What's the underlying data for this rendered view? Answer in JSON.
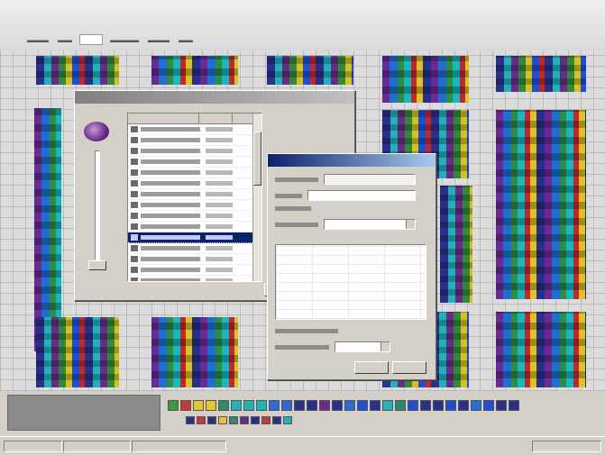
{
  "colors": {
    "desktop": "#d4d0c8",
    "title_active": "#0a246a",
    "selection": "#0a246a",
    "tile_palette": [
      "#2a2f8c",
      "#1bb4b8",
      "#6a2a8a",
      "#2f8a3a",
      "#d7c21a",
      "#1d4fd6",
      "#c2282a"
    ],
    "swatches": [
      "#3a9a3a",
      "#c23a3a",
      "#e6c72a",
      "#e6c72a",
      "#2a8a6a",
      "#1bb4b8",
      "#1bb4b8",
      "#1bb4b8",
      "#2a6ad6",
      "#2a6ad6",
      "#2a2f8c",
      "#2a2f8c",
      "#6a2a8a",
      "#2a2f8c",
      "#2a6ad6",
      "#1d4fd6",
      "#2a2f8c",
      "#1bb4b8",
      "#2a8a6a",
      "#1d4fd6",
      "#2a2f8c",
      "#2a2f8c",
      "#1d4fd6",
      "#2a2f8c",
      "#2a6ad6",
      "#1d4fd6",
      "#2a2f8c",
      "#2a2f8c"
    ],
    "swatches_row2": [
      "#2a2f8c",
      "#c23a3a",
      "#2a2f8c",
      "#e6c72a",
      "#2a8a6a",
      "#6a2a8a",
      "#2a2f8c",
      "#c23a3a",
      "#2a2f8c",
      "#1bb4b8"
    ]
  },
  "icons": {
    "app_logo": "app-logo-icon",
    "combo_arrow": "chevron-down-icon"
  },
  "list_rows_count_visible": 15,
  "selected_row": 10
}
